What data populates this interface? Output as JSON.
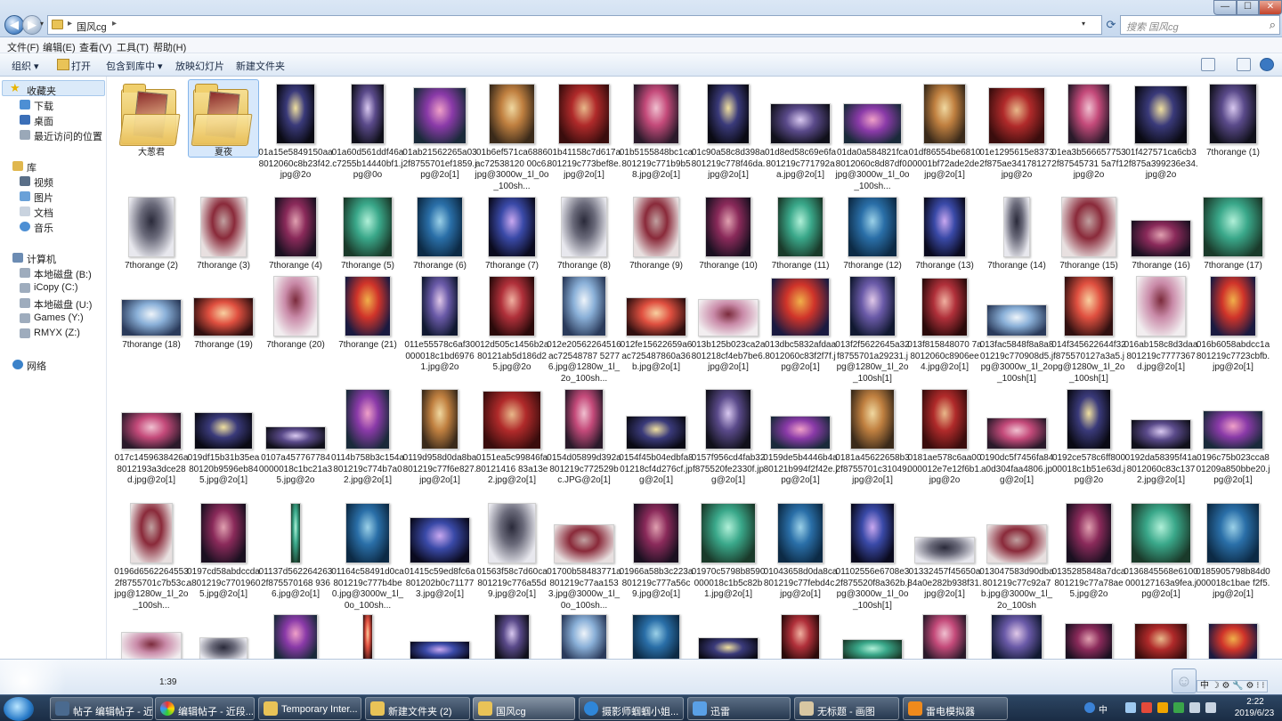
{
  "address": {
    "path": "国风cg",
    "search_placeholder": "搜索 国风cg"
  },
  "window": {
    "min": "—",
    "max": "☐",
    "close": "✕"
  },
  "menu": [
    "文件(F)",
    "编辑(E)",
    "查看(V)",
    "工具(T)",
    "帮助(H)"
  ],
  "toolbar": {
    "organize": "组织 ▾",
    "open": "打开",
    "include": "包含到库中 ▾",
    "slideshow": "放映幻灯片",
    "new_folder": "新建文件夹"
  },
  "sidebar": {
    "favorites": "收藏夹",
    "fav_items": [
      "下载",
      "桌面",
      "最近访问的位置"
    ],
    "libraries": "库",
    "lib_items": [
      "视频",
      "图片",
      "文档",
      "音乐"
    ],
    "computer": "计算机",
    "drives": [
      "本地磁盘 (B:)",
      "iCopy (C:)",
      "本地磁盘 (U:)",
      "Games (Y:)",
      "RMYX (Z:)"
    ],
    "network": "网络"
  },
  "rows": [
    [
      "大葱君",
      "夏夜",
      "01a15e5849150aa8012060c8b23f42.jpg@2o",
      "01a60d561ddf46ac7255b14440bf1.jpg@0o",
      "01ab21562265a032f8755701ef1859.jpg@2o[1]",
      "01b6ef571ca6886ac72538120 00c6.jpg@3000w_1l_0o_100sh...",
      "01b41158c7d617a801219c773bef8e.jpg@2o[1]",
      "01b5155848bc1ca801219c771b9b58.jpg@2o[1]",
      "01c90a58c8d398a801219c778f46da.jpg@2o[1]",
      "01d8ed58c69e6fa801219c771792aa.jpg@2o[1]",
      "01da0a584821fca8012060c8d87df0.jpg@3000w_1l_0o_100sh...",
      "01df86554be681000001bf72ade2de.jpg@2o[1]",
      "01e1295615e83732f875ae34178127.jpg@2o",
      "01ea3b5666577532f87545731 5a7f1.jpg@2o",
      "01f427571ca6cb32f875a399236e34.jpg@2o",
      "7thorange (1)"
    ],
    [
      "7thorange (2)",
      "7thorange (3)",
      "7thorange (4)",
      "7thorange (5)",
      "7thorange (6)",
      "7thorange (7)",
      "7thorange (8)",
      "7thorange (9)",
      "7thorange (10)",
      "7thorange (11)",
      "7thorange (12)",
      "7thorange (13)",
      "7thorange (14)",
      "7thorange (15)",
      "7thorange (16)",
      "7thorange (17)"
    ],
    [
      "7thorange (18)",
      "7thorange (19)",
      "7thorange (20)",
      "7thorange (21)",
      "011e55578c6af30000018c1bd69761.jpg@2o",
      "012d505c1456b2a80121ab5d186d25.jpg@2o",
      "012e20562264516ac72548787 52776.jpg@1280w_1l_2o_100sh...",
      "012fe15622659a6ac725487860a36b.jpg@2o[1]",
      "013b125b023ca2a801218cf4eb7be6.jpg@2o[1]",
      "013dbc5832afdaa8012060c83f2f7f.jpg@2o[1]",
      "013f2f5622645a32f8755701a29231.jpg@1280w_1l_2o_100sh[1]",
      "013f815848070 7a8012060c8906ee4.jpg@2o[1]",
      "013fac5848f8a8a801219c770908d5.jpg@3000w_1l_2o_100sh[1]",
      "014f345622644f32f875570127a3a5.jpg@1280w_1l_2o_100sh[1]",
      "016ab158c8d3daa801219c7777367d.jpg@2o[1]",
      "016b6058abdcc1a801219c7723cbfb.jpg@2o[1]"
    ],
    [
      "017c1459638426a8012193a3dce28d.jpg@2o[1]",
      "019df15b31b35ea80120b9596eb845.jpg@2o[1]",
      "0107a457767784 0000018c1bc21a35.jpg@2o",
      "0114b758b3c154a801219c774b7a02.jpg@2o[1]",
      "0119d958d0da8ba801219c77f6e827.jpg@2o[1]",
      "0151ea5c99846fa80121416 83a13e2.jpg@2o[1]",
      "0154d05899d392a801219c772529bc.JPG@2o[1]",
      "0154f45b04edbfa801218cf4d276cf.jpg@2o[1]",
      "0157f956cd4fab32f875520fe2330f.jpg@2o[1]",
      "0159de5b4446b4a80121b994f2f42e.jpg@2o[1]",
      "0181a45622658b32f8755701c31049.jpg@2o[1]",
      "0181ae578c6aa00000012e7e12f6b1.jpg@2o",
      "0190dc5f7456fa84a0d304faa4806.jpg@2o[1]",
      "0192ce578c6ff80000018c1b51e63d.jpg@2o",
      "0192da58395f41a8012060c83c1372.jpg@2o[1]",
      "0196c75b023cca801209a850bbe20.jpg@2o[1]"
    ],
    [
      "0196d65622645532f8755701c7b53c.jpg@1280w_1l_2o_100sh...",
      "0197cd58abdccdaa801219c77019605.jpg@2o[1]",
      "01137d5622642632f875570168 9366.jpg@2o[1]",
      "01164c58491d0ca801219c777b4be0.jpg@3000w_1l_0o_100sh...",
      "01415c59ed8fc6a801202b0c711773.jpg@2o[1]",
      "01563f58c7d60ca801219c776a55d9.jpg@2o[1]",
      "01700b58483771a801219c77aa1533.jpg@3000w_1l_0o_100sh...",
      "01966a58b3c223a801219c777a56c9.jpg@2o[1]",
      "01970c5798b8590000018c1b5c82b1.jpg@2o[1]",
      "01043658d0da8ca801219c77febd4c.jpg@2o[1]",
      "01102556e6708e32f875520f8a362b.jpg@3000w_1l_0o_100sh[1]",
      "01332457f45650a84a0e282b938f31.jpg@2o[1]",
      "013047583d90dba801219c77c92a7b.jpg@3000w_1l_2o_100sh",
      "0135285848a7dca801219c77a78ae5.jpg@2o",
      "0136845568e6100000127163a9fea.jpg@2o[1]",
      "0185905798b84d0000018c1bae f2f5.jpg@2o[1]"
    ]
  ],
  "details": {
    "duration": "1:39"
  },
  "ime": "中 ☽ ⚙ 🔧 ⚙ ⁝ ⁝",
  "taskbar": {
    "items": [
      "帖子 编辑帖子 - 近...",
      "编辑帖子 - 近段...",
      "Temporary Inter...",
      "新建文件夹 (2)",
      "国风cg",
      "摄影师蝈蝈小姐...",
      "迅雷",
      "无标题 - 画图",
      "雷电模拟器"
    ],
    "time": "2:22",
    "date": "2019/6/23",
    "tray_text": "中"
  }
}
